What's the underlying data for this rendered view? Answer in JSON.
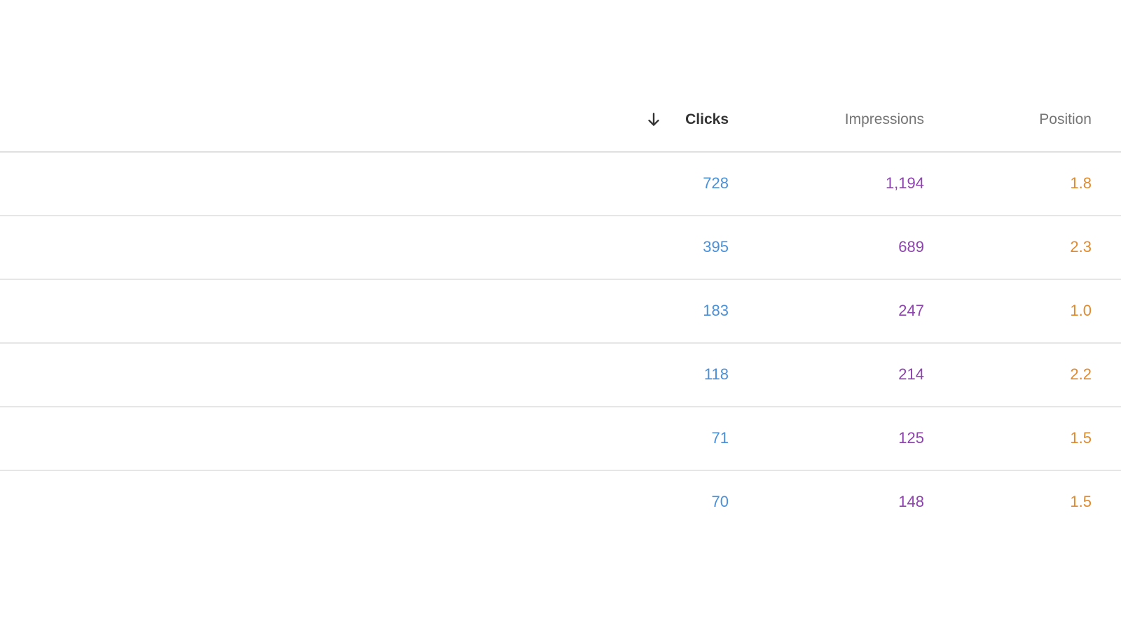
{
  "table": {
    "columns": {
      "clicks": "Clicks",
      "impressions": "Impressions",
      "position": "Position"
    },
    "sort": {
      "column": "clicks",
      "direction": "descending",
      "icon": "arrow-down-icon"
    },
    "colors": {
      "clicks": "#4a90d9",
      "impressions": "#8e44ad",
      "position": "#e08a2e"
    },
    "rows": [
      {
        "clicks": "728",
        "impressions": "1,194",
        "position": "1.8"
      },
      {
        "clicks": "395",
        "impressions": "689",
        "position": "2.3"
      },
      {
        "clicks": "183",
        "impressions": "247",
        "position": "1.0"
      },
      {
        "clicks": "118",
        "impressions": "214",
        "position": "2.2"
      },
      {
        "clicks": "71",
        "impressions": "125",
        "position": "1.5"
      },
      {
        "clicks": "70",
        "impressions": "148",
        "position": "1.5"
      }
    ]
  }
}
